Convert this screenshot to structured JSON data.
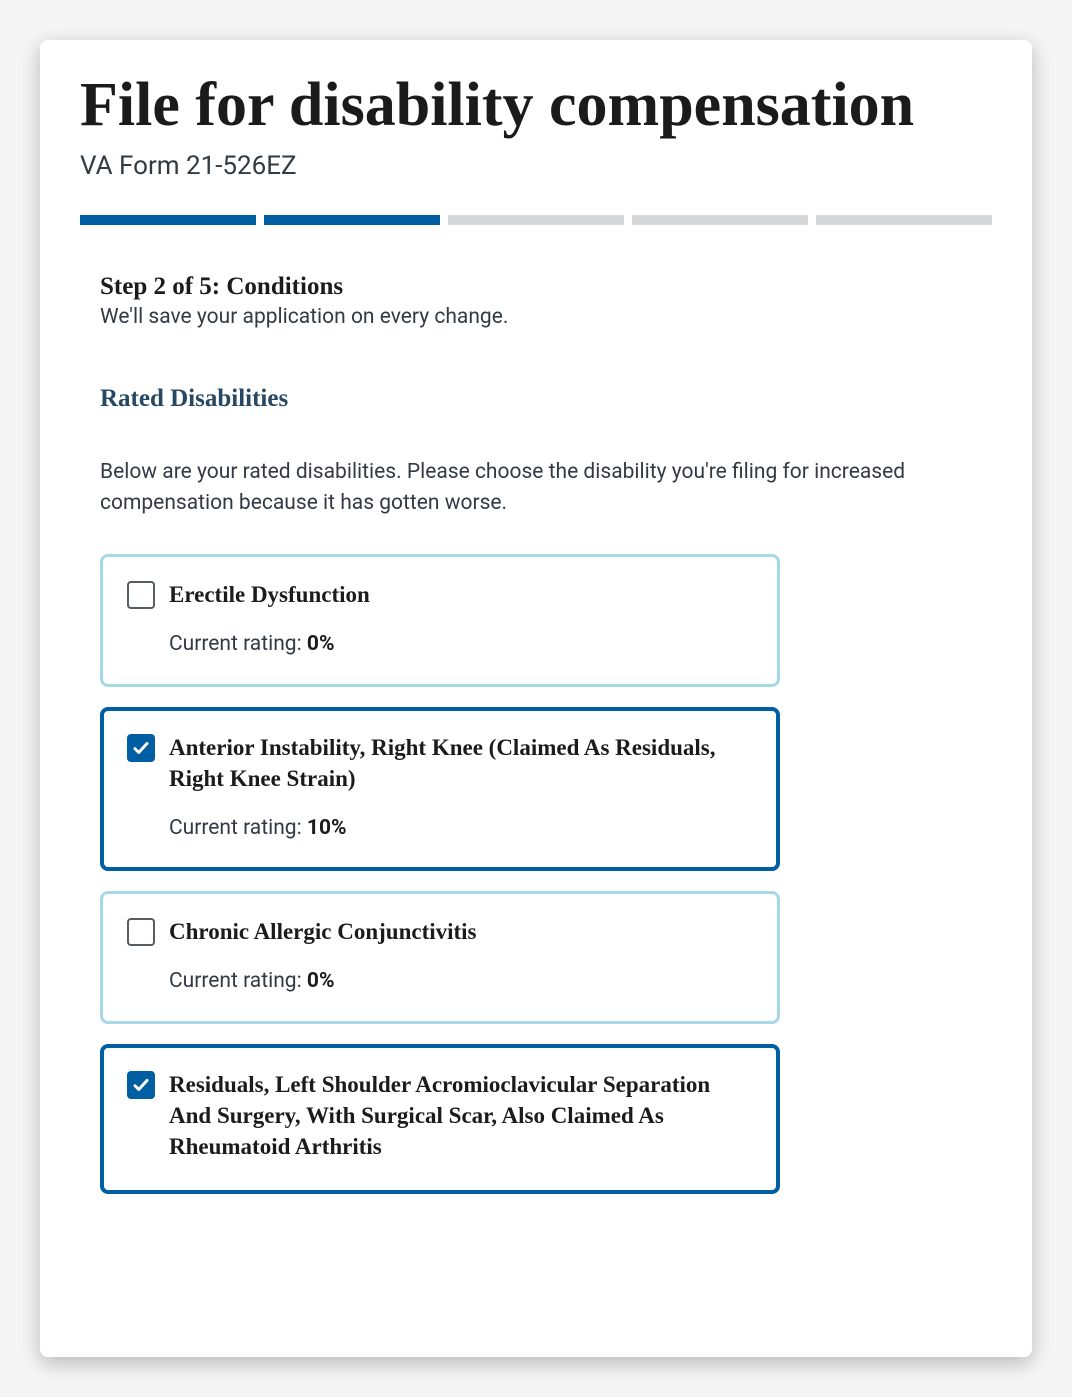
{
  "header": {
    "title": "File for disability compensation",
    "form_number": "VA Form 21-526EZ"
  },
  "progress": {
    "total": 5,
    "current": 2
  },
  "step": {
    "label": "Step 2 of 5: Conditions",
    "autosave_note": "We'll save your application on every change."
  },
  "section": {
    "heading": "Rated Disabilities",
    "intro": "Below are your rated disabilities. Please choose the disability you're filing for increased compensation because it has gotten worse."
  },
  "rating_prefix": "Current rating: ",
  "disabilities": [
    {
      "label": "Erectile Dysfunction",
      "rating": "0%",
      "selected": false
    },
    {
      "label": "Anterior Instability, Right Knee (Claimed As Residuals, Right Knee Strain)",
      "rating": "10%",
      "selected": true
    },
    {
      "label": "Chronic Allergic Conjunctivitis",
      "rating": "0%",
      "selected": false
    },
    {
      "label": "Residuals, Left Shoulder Acromioclavicular Separation And Surgery, With Surgical Scar, Also Claimed As Rheumatoid Arthritis",
      "rating": "",
      "selected": true
    }
  ]
}
